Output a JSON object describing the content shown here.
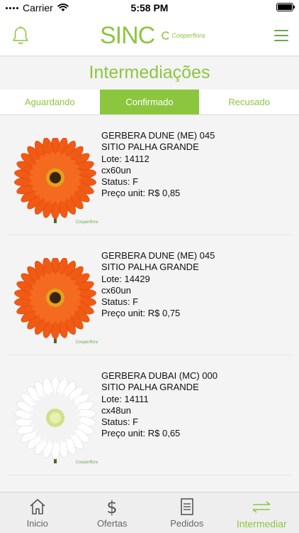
{
  "status_bar": {
    "carrier": "Carrier",
    "time": "5:58 PM",
    "wifi_icon": "wifi-icon",
    "battery_level": 1.0
  },
  "header": {
    "bell_icon": "bell-icon",
    "logo_text": "SINC",
    "partner_logo_text": "Cooperflora",
    "menu_icon": "hamburger-menu-icon",
    "accent_color": "#8cc63f"
  },
  "page": {
    "title": "Intermediações"
  },
  "tabs": [
    {
      "label": "Aguardando",
      "active": false
    },
    {
      "label": "Confirmado",
      "active": true
    },
    {
      "label": "Recusado",
      "active": false
    }
  ],
  "items": [
    {
      "product": "GERBERA DUNE (ME) 045",
      "producer": "SITIO PALHA GRANDE",
      "lote": "Lote: 14112",
      "package": "cx60un",
      "status": "Status: F",
      "price": "Preço unit: R$ 0,85",
      "flower_color": "#f05a14",
      "image_logo": "Cooperflora"
    },
    {
      "product": "GERBERA DUNE (ME) 045",
      "producer": "SITIO PALHA GRANDE",
      "lote": "Lote: 14429",
      "package": "cx60un",
      "status": "Status: F",
      "price": "Preço unit: R$ 0,75",
      "flower_color": "#f05a14",
      "image_logo": "Cooperflora"
    },
    {
      "product": "GERBERA DUBAI (MC) 000",
      "producer": "SITIO PALHA GRANDE",
      "lote": "Lote: 14111",
      "package": "cx48un",
      "status": "Status: F",
      "price": "Preço unit: R$ 0,65",
      "flower_color": "#ffffff",
      "image_logo": "Cooperflora"
    }
  ],
  "bottom_nav": [
    {
      "label": "Inicio",
      "icon": "home-icon",
      "active": false
    },
    {
      "label": "Ofertas",
      "icon": "dollar-icon",
      "active": false
    },
    {
      "label": "Pedidos",
      "icon": "document-icon",
      "active": false
    },
    {
      "label": "Intermediar",
      "icon": "swap-arrows-icon",
      "active": true
    }
  ]
}
